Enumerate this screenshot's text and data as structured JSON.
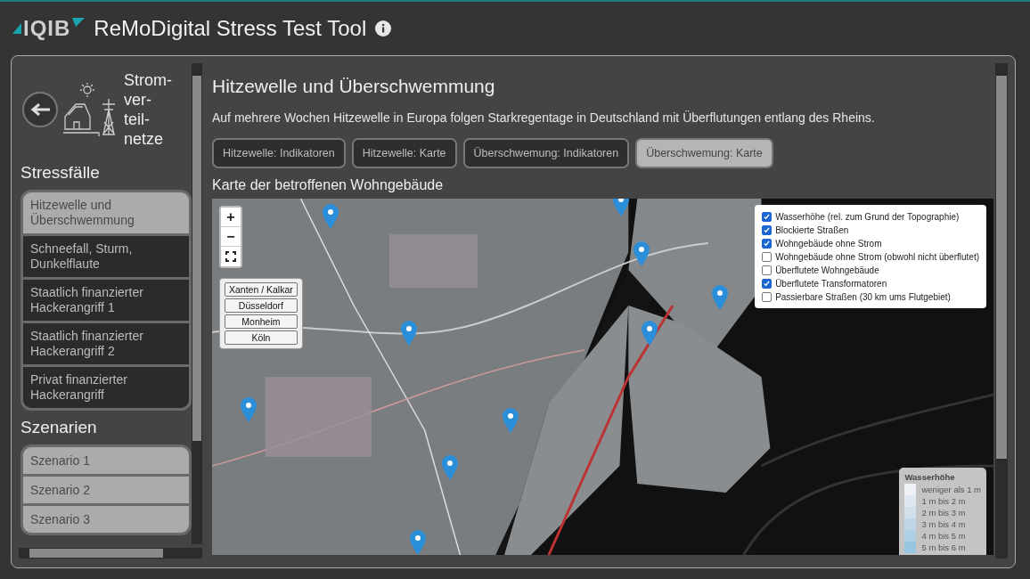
{
  "header": {
    "logo": "IQIB",
    "title": "ReMoDigital Stress Test Tool"
  },
  "sidebar": {
    "section_title": "Strom-ver-teil-netze",
    "stress_heading": "Stressfälle",
    "stress_cases": [
      {
        "label": "Hitzewelle und Überschwemmung",
        "selected": true
      },
      {
        "label": "Schneefall, Sturm, Dunkelflaute",
        "selected": false
      },
      {
        "label": "Staatlich finanzierter Hackerangriff 1",
        "selected": false
      },
      {
        "label": "Staatlich finanzierter Hackerangriff 2",
        "selected": false
      },
      {
        "label": "Privat finanzierter Hackerangriff",
        "selected": false
      }
    ],
    "scenario_heading": "Szenarien",
    "scenarios": [
      "Szenario 1",
      "Szenario 2",
      "Szenario 3"
    ]
  },
  "content": {
    "title": "Hitzewelle und Überschwemmung",
    "description": "Auf mehrere Wochen Hitzewelle in Europa folgen Starkregentage in Deutschland mit Überflutungen entlang des Rheins.",
    "tabs": [
      {
        "label": "Hitzewelle: Indikatoren",
        "selected": false
      },
      {
        "label": "Hitzewelle: Karte",
        "selected": false
      },
      {
        "label": "Überschwemung: Indikatoren",
        "selected": false
      },
      {
        "label": "Überschwemung: Karte",
        "selected": true
      }
    ],
    "map_title": "Karte der betroffenen Wohngebäude",
    "map": {
      "zoom_in": "+",
      "zoom_out": "−",
      "places": [
        "Xanten / Kalkar",
        "Düsseldorf",
        "Monheim",
        "Köln"
      ],
      "layers": [
        {
          "label": "Wasserhöhe (rel. zum Grund der Topographie)",
          "checked": true
        },
        {
          "label": "Blockierte Straßen",
          "checked": true
        },
        {
          "label": "Wohngebäude ohne Strom",
          "checked": true
        },
        {
          "label": "Wohngebäude ohne Strom (obwohl nicht überflutet)",
          "checked": false
        },
        {
          "label": "Überflutete Wohngebäude",
          "checked": false
        },
        {
          "label": "Überflutete Transformatoren",
          "checked": true
        },
        {
          "label": "Passierbare Straßen (30 km ums Flutgebiet)",
          "checked": false
        }
      ],
      "legend": {
        "title": "Wasserhöhe",
        "items": [
          {
            "label": "weniger als 1 m",
            "color": "#eef2f6"
          },
          {
            "label": "1 m bis 2 m",
            "color": "#dfe8f0"
          },
          {
            "label": "2 m bis 3 m",
            "color": "#d0dfea"
          },
          {
            "label": "3 m bis 4 m",
            "color": "#c0d6e6"
          },
          {
            "label": "4 m bis 5 m",
            "color": "#add0e4"
          },
          {
            "label": "5 m bis 6 m",
            "color": "#98c6e0"
          }
        ]
      }
    }
  }
}
